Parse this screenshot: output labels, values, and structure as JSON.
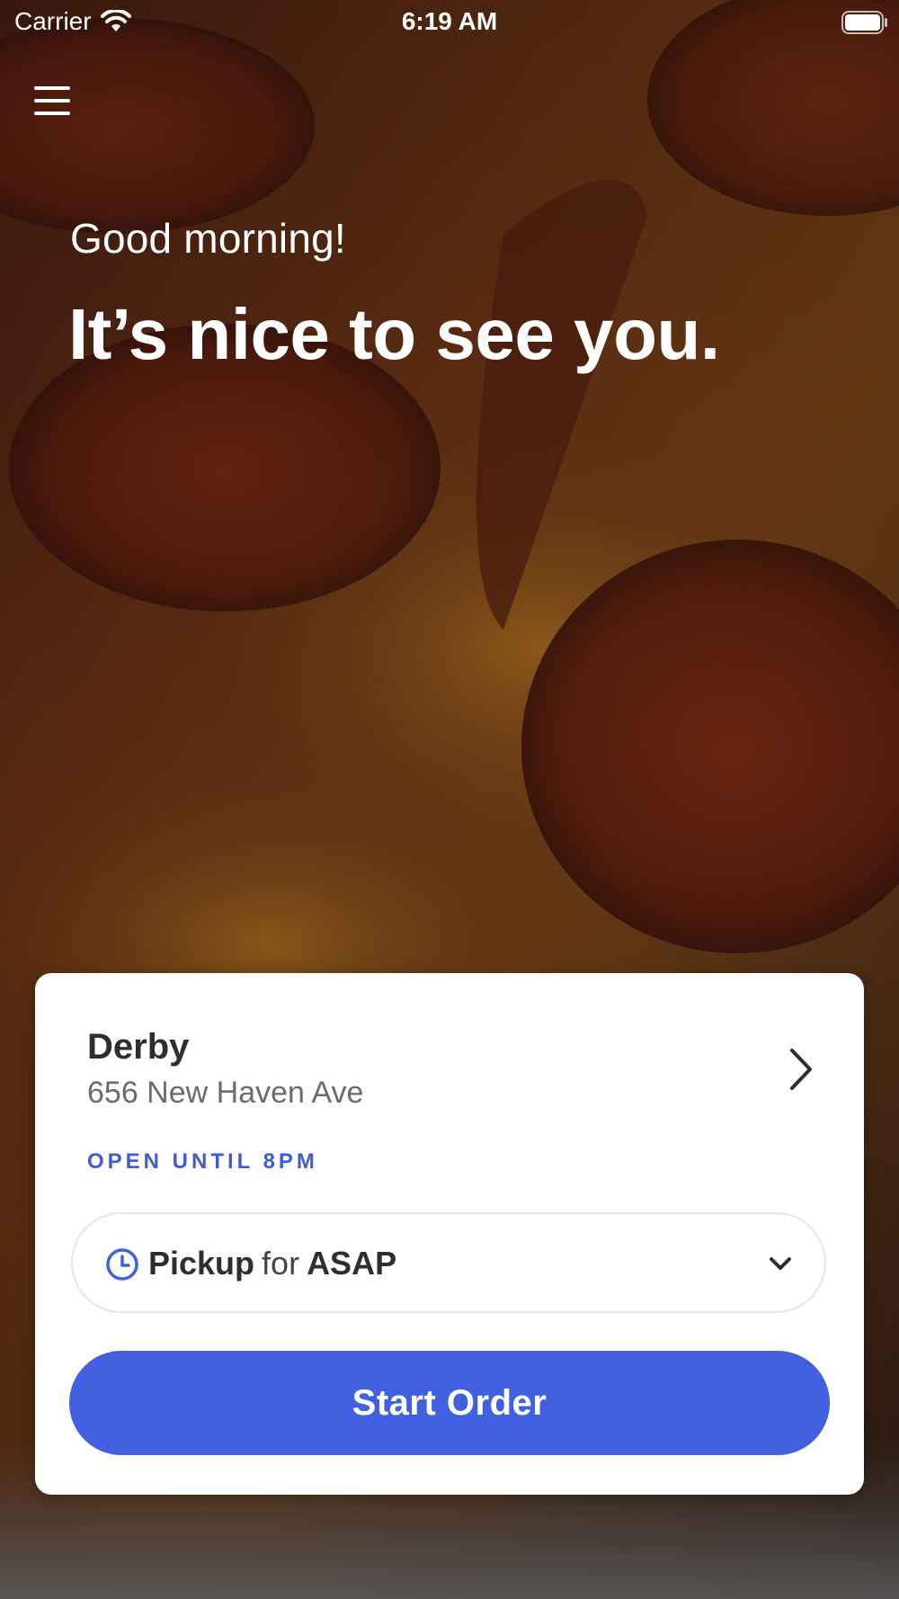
{
  "status_bar": {
    "carrier": "Carrier",
    "time": "6:19 AM"
  },
  "hero": {
    "greeting": "Good morning!",
    "headline": "It’s nice to see you."
  },
  "store": {
    "name": "Derby",
    "address": "656 New Haven Ave",
    "hours": "OPEN UNTIL 8PM"
  },
  "order_mode": {
    "mode": "Pickup",
    "connector": "for",
    "time": "ASAP"
  },
  "actions": {
    "start_order": "Start Order"
  },
  "icons": {
    "menu": "hamburger-menu-icon",
    "store_chevron": "chevron-right-icon",
    "clock": "clock-icon",
    "dropdown": "chevron-down-icon",
    "wifi": "wifi-icon",
    "battery": "battery-icon"
  },
  "colors": {
    "accent": "#4160df",
    "text_dark": "#2e2e2e",
    "text_muted": "#6b6b6b",
    "card_bg": "#ffffff"
  }
}
